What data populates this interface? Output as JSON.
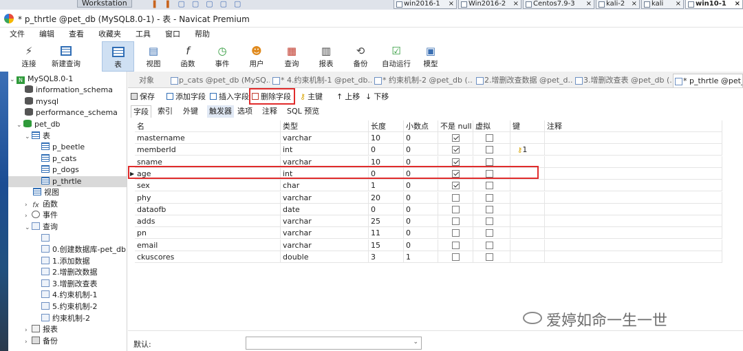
{
  "vmware": {
    "menu_label": "Workstation",
    "tabs": [
      "win2016-1",
      "Win2016-2",
      "Centos7.9-3",
      "kali-2",
      "kali",
      "win10-1"
    ]
  },
  "window": {
    "title": "* p_thrtle @pet_db (MySQL8.0-1) - 表 - Navicat Premium"
  },
  "menu": [
    "文件",
    "编辑",
    "查看",
    "收藏夹",
    "工具",
    "窗口",
    "帮助"
  ],
  "toolbar": [
    "连接",
    "新建查询",
    "表",
    "视图",
    "函数",
    "事件",
    "用户",
    "查询",
    "报表",
    "备份",
    "自动运行",
    "模型"
  ],
  "navigator": {
    "connection": "MySQL8.0-1",
    "databases": [
      "information_schema",
      "mysql",
      "performance_schema",
      "pet_db"
    ],
    "group_tables": "表",
    "tables": [
      "p_beetle",
      "p_cats",
      "p_dogs",
      "p_thrtle"
    ],
    "group_views": "视图",
    "group_functions": "函数",
    "group_events": "事件",
    "group_queries": "查询",
    "queries": [
      "0.创建数据库-pet_db",
      "1.添加数据",
      "2.增删改数据",
      "3.增删改查表",
      "4.约束机制-1",
      "5.约束机制-2",
      "约束机制-2"
    ],
    "group_reports": "报表",
    "group_backups": "备份"
  },
  "object_tabs": [
    "对象",
    "p_cats @pet_db (MySQ...",
    "* 4.约束机制-1 @pet_db...",
    "* 约束机制-2 @pet_db (...",
    "2.增删改查数据 @pet_d...",
    "3.增删改查表 @pet_db (...",
    "* p_thrtle @pet_db"
  ],
  "designer_toolbar": {
    "save": "保存",
    "add_field": "添加字段",
    "insert_field": "插入字段",
    "delete_field": "删除字段",
    "primary_key": "主键",
    "move_up": "上移",
    "move_down": "下移"
  },
  "sub_tabs": [
    "字段",
    "索引",
    "外键",
    "触发器",
    "选项",
    "注释",
    "SQL 预览"
  ],
  "columns": [
    "名",
    "类型",
    "长度",
    "小数点",
    "不是 null",
    "虚拟",
    "键",
    "注释"
  ],
  "fields": [
    {
      "name": "mastername",
      "type": "varchar",
      "length": "10",
      "decimals": "0",
      "not_null": true,
      "virtual": false,
      "key": ""
    },
    {
      "name": "memberId",
      "type": "int",
      "length": "0",
      "decimals": "0",
      "not_null": true,
      "virtual": false,
      "key": "1"
    },
    {
      "name": "sname",
      "type": "varchar",
      "length": "10",
      "decimals": "0",
      "not_null": true,
      "virtual": false,
      "key": ""
    },
    {
      "name": "age",
      "type": "int",
      "length": "0",
      "decimals": "0",
      "not_null": true,
      "virtual": false,
      "key": ""
    },
    {
      "name": "sex",
      "type": "char",
      "length": "1",
      "decimals": "0",
      "not_null": true,
      "virtual": false,
      "key": ""
    },
    {
      "name": "phy",
      "type": "varchar",
      "length": "20",
      "decimals": "0",
      "not_null": false,
      "virtual": false,
      "key": ""
    },
    {
      "name": "dataofb",
      "type": "date",
      "length": "0",
      "decimals": "0",
      "not_null": false,
      "virtual": false,
      "key": ""
    },
    {
      "name": "adds",
      "type": "varchar",
      "length": "25",
      "decimals": "0",
      "not_null": false,
      "virtual": false,
      "key": ""
    },
    {
      "name": "pn",
      "type": "varchar",
      "length": "11",
      "decimals": "0",
      "not_null": false,
      "virtual": false,
      "key": ""
    },
    {
      "name": "email",
      "type": "varchar",
      "length": "15",
      "decimals": "0",
      "not_null": false,
      "virtual": false,
      "key": ""
    },
    {
      "name": "ckuscores",
      "type": "double",
      "length": "3",
      "decimals": "1",
      "not_null": false,
      "virtual": false,
      "key": ""
    }
  ],
  "bottom": {
    "default_label": "默认:",
    "default_value": ""
  },
  "watermark": "爱婷如命一生一世",
  "colors": {
    "highlight_border": "#e02b2b",
    "selected_toolbar": "#cfe0f3",
    "key_icon": "#d9a400"
  }
}
